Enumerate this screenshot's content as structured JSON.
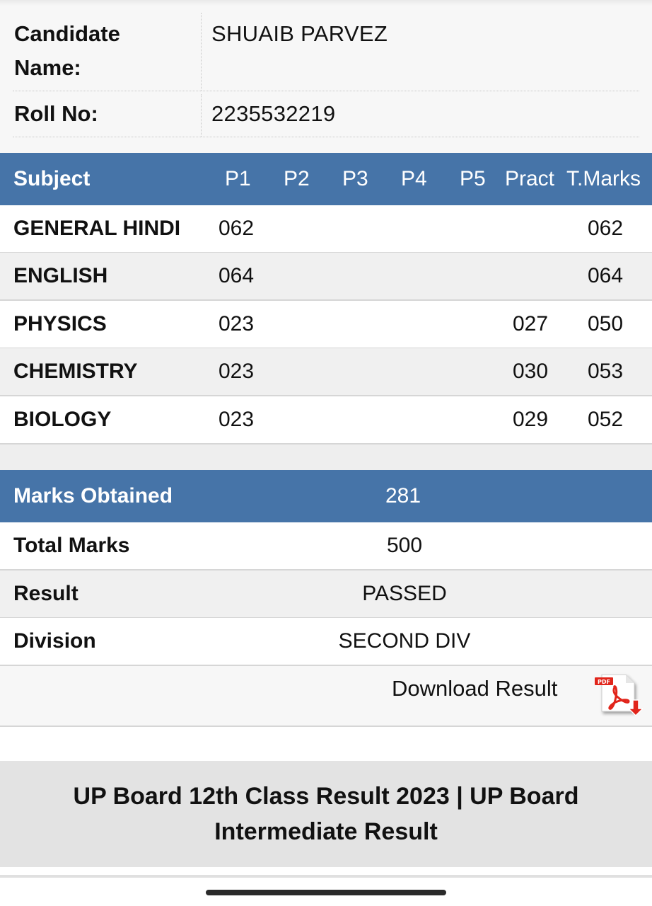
{
  "candidate": {
    "name_label": "Candidate Name:",
    "name_value": "SHUAIB PARVEZ",
    "roll_label": "Roll No:",
    "roll_value": "2235532219"
  },
  "marks_table": {
    "headers": {
      "subject": "Subject",
      "p1": "P1",
      "p2": "P2",
      "p3": "P3",
      "p4": "P4",
      "p5": "P5",
      "pract": "Pract",
      "total": "T.Marks"
    },
    "rows": [
      {
        "subject": "GENERAL HINDI",
        "p1": "062",
        "pract": "",
        "total": "062"
      },
      {
        "subject": "ENGLISH",
        "p1": "064",
        "pract": "",
        "total": "064"
      },
      {
        "subject": "PHYSICS",
        "p1": "023",
        "pract": "027",
        "total": "050"
      },
      {
        "subject": "CHEMISTRY",
        "p1": "023",
        "pract": "030",
        "total": "053"
      },
      {
        "subject": "BIOLOGY",
        "p1": "023",
        "pract": "029",
        "total": "052"
      }
    ]
  },
  "summary": {
    "obtained_label": "Marks Obtained",
    "obtained_value": "281",
    "total_label": "Total Marks",
    "total_value": "500",
    "result_label": "Result",
    "result_value": "PASSED",
    "division_label": "Division",
    "division_value": "SECOND DIV"
  },
  "download": {
    "label": "Download Result",
    "icon": "pdf-download-icon",
    "icon_badge": "PDF"
  },
  "banner": {
    "title": "UP Board 12th Class Result 2023 | UP Board Intermediate Result"
  },
  "colors": {
    "header_blue": "#4674a8",
    "pdf_red": "#e1251b"
  }
}
